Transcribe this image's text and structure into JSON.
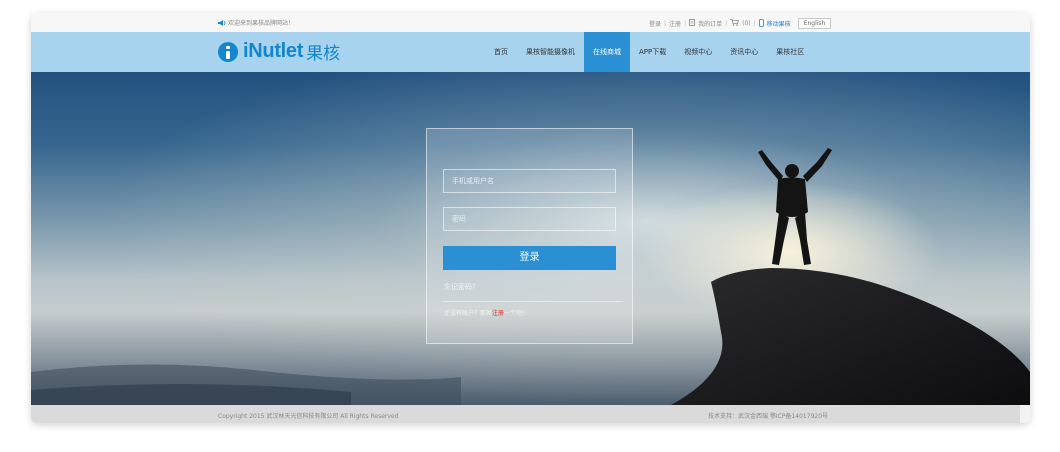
{
  "topbar": {
    "welcome": "欢迎来到果核品牌网站！",
    "login": "登录",
    "register": "注册",
    "orders": "我的订单",
    "cart": "(0)",
    "mobile": "移动果核",
    "language": "English"
  },
  "nav": {
    "brand": "iNutlet",
    "brand_cn": "果核",
    "items": [
      "首页",
      "果核智能摄像机",
      "在线商城",
      "APP下载",
      "视频中心",
      "资讯中心",
      "果核社区"
    ],
    "active_index": 2
  },
  "login_form": {
    "username_placeholder": "手机或用户名",
    "password_placeholder": "密码",
    "submit": "登录",
    "forgot": "忘记密码？",
    "no_account": "还没有账户？那就",
    "register_link": "注册",
    "no_account_end": "一个吧！"
  },
  "footer": {
    "copyright": "Copyright 2015 武汉林天光信科技有限公司 All Rights Reserved",
    "support": "技术支持：武汉金西瑞 鄂ICP备14017920号"
  },
  "colors": {
    "brand": "#1585cd",
    "nav_bg": "#a7d3ef",
    "active": "#2b8fd3",
    "accent_red": "#e02828"
  }
}
